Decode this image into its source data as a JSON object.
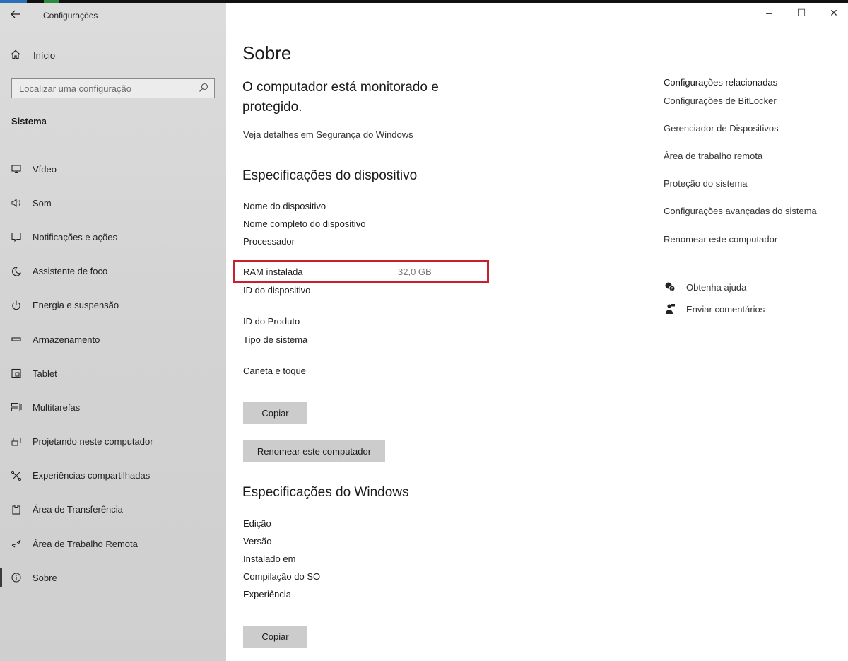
{
  "window": {
    "app_title": "Configurações",
    "controls": {
      "minimize": "–",
      "maximize": "☐",
      "close": "✕"
    }
  },
  "sidebar": {
    "home_label": "Início",
    "search_placeholder": "Localizar uma configuração",
    "section": "Sistema",
    "items": [
      {
        "label": "Vídeo",
        "icon": "monitor-icon"
      },
      {
        "label": "Som",
        "icon": "speaker-icon"
      },
      {
        "label": "Notificações e ações",
        "icon": "notification-icon"
      },
      {
        "label": "Assistente de foco",
        "icon": "moon-icon"
      },
      {
        "label": "Energia e suspensão",
        "icon": "power-icon"
      },
      {
        "label": "Armazenamento",
        "icon": "storage-icon"
      },
      {
        "label": "Tablet",
        "icon": "tablet-icon"
      },
      {
        "label": "Multitarefas",
        "icon": "multitask-icon"
      },
      {
        "label": "Projetando neste computador",
        "icon": "projector-icon"
      },
      {
        "label": "Experiências compartilhadas",
        "icon": "shared-icon"
      },
      {
        "label": "Área de Transferência",
        "icon": "clipboard-icon"
      },
      {
        "label": "Área de Trabalho Remota",
        "icon": "remote-desktop-icon"
      },
      {
        "label": "Sobre",
        "icon": "info-icon",
        "selected": true
      }
    ]
  },
  "main": {
    "title": "Sobre",
    "security_status": "O computador está monitorado e protegido.",
    "security_link": "Veja detalhes em Segurança do Windows",
    "device_specs": {
      "heading": "Especificações do dispositivo",
      "device_name": "Nome do dispositivo",
      "full_device_name": "Nome completo do dispositivo",
      "processor": "Processador",
      "ram_label": "RAM instalada",
      "ram_value": "32,0 GB",
      "device_id": "ID do dispositivo",
      "product_id": "ID do Produto",
      "system_type": "Tipo de sistema",
      "pen_touch": "Caneta e toque",
      "copy_button": "Copiar",
      "rename_button": "Renomear este computador"
    },
    "windows_specs": {
      "heading": "Especificações do Windows",
      "edition": "Edição",
      "version": "Versão",
      "installed_on": "Instalado em",
      "os_build": "Compilação do SO",
      "experience": "Experiência",
      "copy_button": "Copiar"
    }
  },
  "related": {
    "heading": "Configurações relacionadas",
    "links": [
      "Configurações de BitLocker",
      "Gerenciador de Dispositivos",
      "Área de trabalho remota",
      "Proteção do sistema",
      "Configurações avançadas do sistema",
      "Renomear este computador"
    ],
    "help": "Obtenha ajuda",
    "feedback": "Enviar comentários"
  },
  "colors": {
    "highlight_box": "#c8202f",
    "sidebar_bg": "#d5d5d5",
    "button_bg": "#cccccc"
  }
}
